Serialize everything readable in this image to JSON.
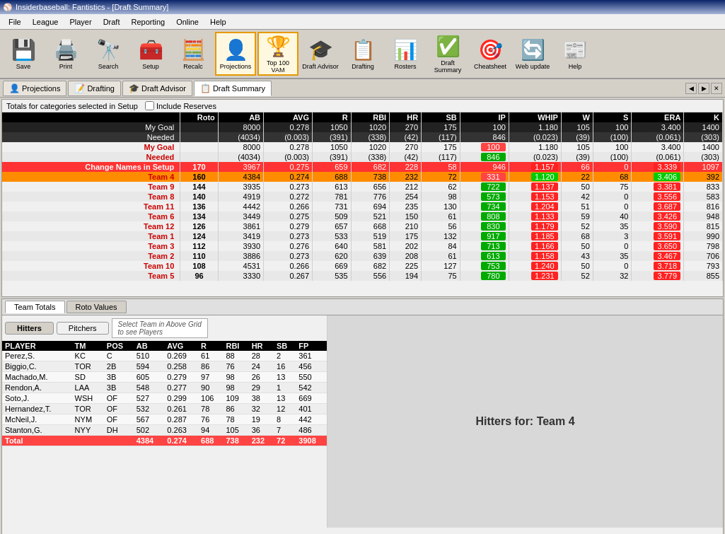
{
  "titlebar": {
    "title": "Insiderbaseball: Fantistics - [Draft Summary]",
    "icon": "⚾"
  },
  "menubar": {
    "items": [
      "File",
      "League",
      "Player",
      "Draft",
      "Reporting",
      "Online",
      "Help"
    ]
  },
  "toolbar": {
    "buttons": [
      {
        "id": "save",
        "label": "Save",
        "icon": "💾"
      },
      {
        "id": "print",
        "label": "Print",
        "icon": "🖨️"
      },
      {
        "id": "search",
        "label": "Search",
        "icon": "🔭"
      },
      {
        "id": "setup",
        "label": "Setup",
        "icon": "🧰"
      },
      {
        "id": "recalc",
        "label": "Recalc",
        "icon": "🧮"
      },
      {
        "id": "projections",
        "label": "Projections",
        "icon": "👤"
      },
      {
        "id": "top100",
        "label": "Top 100 VAM",
        "icon": "🏆"
      },
      {
        "id": "advisor",
        "label": "Draft Advisor",
        "icon": "🎓"
      },
      {
        "id": "drafting",
        "label": "Drafting",
        "icon": "📋"
      },
      {
        "id": "rosters",
        "label": "Rosters",
        "icon": "📊"
      },
      {
        "id": "draftsummary",
        "label": "Draft Summary",
        "icon": "✅"
      },
      {
        "id": "cheatsheet",
        "label": "Cheatsheet",
        "icon": "🎯"
      },
      {
        "id": "webupdate",
        "label": "Web update",
        "icon": "🔄"
      },
      {
        "id": "help",
        "label": "Help",
        "icon": "📰"
      }
    ]
  },
  "tabs": [
    {
      "id": "projections",
      "label": "Projections",
      "icon": "👤",
      "active": false
    },
    {
      "id": "drafting",
      "label": "Drafting",
      "icon": "📝",
      "active": false
    },
    {
      "id": "draftadvisor",
      "label": "Draft Advisor",
      "icon": "🎓",
      "active": false
    },
    {
      "id": "draftsummary",
      "label": "Draft Summary",
      "icon": "📋",
      "active": true
    }
  ],
  "grid": {
    "totals_label": "Totals for categories selected in Setup",
    "include_reserves_label": "Include Reserves",
    "columns": [
      "",
      "Roto",
      "AB",
      "AVG",
      "R",
      "RBI",
      "HR",
      "SB",
      "IP",
      "WHIP",
      "W",
      "S",
      "ERA",
      "K"
    ],
    "rows": [
      {
        "label": "My Goal",
        "roto": "",
        "ab": "8000",
        "avg": "0.278",
        "r": "1050",
        "rbi": "1020",
        "hr": "270",
        "sb": "175",
        "ip": "100",
        "whip": "1.180",
        "w": "105",
        "s": "100",
        "era": "3.400",
        "k": "1400",
        "type": "goal"
      },
      {
        "label": "Needed",
        "roto": "",
        "ab": "(4034)",
        "avg": "(0.003)",
        "r": "(391)",
        "rbi": "(338)",
        "hr": "(42)",
        "sb": "(117)",
        "ip": "846",
        "whip": "(0.023)",
        "w": "(39)",
        "s": "(100)",
        "era": "(0.061)",
        "k": "(303)",
        "type": "needed"
      },
      {
        "label": "Change Names in Setup",
        "roto": "170",
        "ab": "3967",
        "avg": "0.275",
        "r": "659",
        "rbi": "682",
        "hr": "228",
        "sb": "58",
        "ip": "946",
        "whip": "1.157",
        "w": "66",
        "s": "0",
        "era": "3.339",
        "k": "1097",
        "type": "change"
      },
      {
        "label": "Team 4",
        "roto": "160",
        "ab": "4384",
        "avg": "0.274",
        "r": "688",
        "rbi": "738",
        "hr": "232",
        "sb": "72",
        "ip": "331",
        "whip": "1.120",
        "w": "22",
        "s": "68",
        "era": "3.406",
        "k": "392",
        "type": "team4"
      },
      {
        "label": "Team 9",
        "roto": "144",
        "ab": "3935",
        "avg": "0.273",
        "r": "613",
        "rbi": "656",
        "hr": "212",
        "sb": "62",
        "ip": "722",
        "whip": "1.137",
        "w": "50",
        "s": "75",
        "era": "3.381",
        "k": "833",
        "type": "normal"
      },
      {
        "label": "Team 8",
        "roto": "140",
        "ab": "4919",
        "avg": "0.272",
        "r": "781",
        "rbi": "776",
        "hr": "254",
        "sb": "98",
        "ip": "573",
        "whip": "1.153",
        "w": "42",
        "s": "0",
        "era": "3.556",
        "k": "583",
        "type": "normal"
      },
      {
        "label": "Team 11",
        "roto": "136",
        "ab": "4442",
        "avg": "0.266",
        "r": "731",
        "rbi": "694",
        "hr": "235",
        "sb": "130",
        "ip": "734",
        "whip": "1.204",
        "w": "51",
        "s": "0",
        "era": "3.687",
        "k": "816",
        "type": "normal"
      },
      {
        "label": "Team 6",
        "roto": "134",
        "ab": "3449",
        "avg": "0.275",
        "r": "509",
        "rbi": "521",
        "hr": "150",
        "sb": "61",
        "ip": "808",
        "whip": "1.133",
        "w": "59",
        "s": "40",
        "era": "3.426",
        "k": "948",
        "type": "normal"
      },
      {
        "label": "Team 12",
        "roto": "126",
        "ab": "3861",
        "avg": "0.279",
        "r": "657",
        "rbi": "668",
        "hr": "210",
        "sb": "56",
        "ip": "830",
        "whip": "1.179",
        "w": "52",
        "s": "35",
        "era": "3.590",
        "k": "815",
        "type": "normal"
      },
      {
        "label": "Team 1",
        "roto": "124",
        "ab": "3419",
        "avg": "0.273",
        "r": "533",
        "rbi": "519",
        "hr": "175",
        "sb": "132",
        "ip": "917",
        "whip": "1.185",
        "w": "68",
        "s": "3",
        "era": "3.591",
        "k": "990",
        "type": "normal"
      },
      {
        "label": "Team 3",
        "roto": "112",
        "ab": "3930",
        "avg": "0.276",
        "r": "640",
        "rbi": "581",
        "hr": "202",
        "sb": "84",
        "ip": "713",
        "whip": "1.166",
        "w": "50",
        "s": "0",
        "era": "3.650",
        "k": "798",
        "type": "normal"
      },
      {
        "label": "Team 2",
        "roto": "110",
        "ab": "3886",
        "avg": "0.273",
        "r": "620",
        "rbi": "639",
        "hr": "208",
        "sb": "61",
        "ip": "613",
        "whip": "1.158",
        "w": "43",
        "s": "35",
        "era": "3.467",
        "k": "706",
        "type": "normal"
      },
      {
        "label": "Team 10",
        "roto": "108",
        "ab": "4531",
        "avg": "0.266",
        "r": "669",
        "rbi": "682",
        "hr": "225",
        "sb": "127",
        "ip": "753",
        "whip": "1.240",
        "w": "50",
        "s": "0",
        "era": "3.718",
        "k": "793",
        "type": "normal"
      },
      {
        "label": "Team 5",
        "roto": "96",
        "ab": "3330",
        "avg": "0.267",
        "r": "535",
        "rbi": "556",
        "hr": "194",
        "sb": "75",
        "ip": "780",
        "whip": "1.231",
        "w": "52",
        "s": "32",
        "era": "3.779",
        "k": "855",
        "type": "normal"
      }
    ]
  },
  "bottom": {
    "tabs": [
      "Team Totals",
      "Roto Values"
    ],
    "active_tab": "Team Totals",
    "hitter_pitcher": {
      "hitter_label": "Hitters",
      "pitcher_label": "Pitchers",
      "note": "Select Team in Above Grid\nto see Players",
      "active": "hitters"
    },
    "right_header": "Hitters for: Team 4",
    "player_columns": [
      "PLAYER",
      "TM",
      "POS",
      "AB",
      "AVG",
      "R",
      "RBI",
      "HR",
      "SB",
      "FP"
    ],
    "players": [
      {
        "player": "Perez,S.",
        "tm": "KC",
        "pos": "C",
        "ab": "510",
        "avg": "0.269",
        "r": "61",
        "rbi": "88",
        "hr": "28",
        "sb": "2",
        "fp": "361"
      },
      {
        "player": "Biggio,C.",
        "tm": "TOR",
        "pos": "2B",
        "ab": "594",
        "avg": "0.258",
        "r": "86",
        "rbi": "76",
        "hr": "24",
        "sb": "16",
        "fp": "456"
      },
      {
        "player": "Machado,M.",
        "tm": "SD",
        "pos": "3B",
        "ab": "605",
        "avg": "0.279",
        "r": "97",
        "rbi": "98",
        "hr": "26",
        "sb": "13",
        "fp": "550"
      },
      {
        "player": "Rendon,A.",
        "tm": "LAA",
        "pos": "3B",
        "ab": "548",
        "avg": "0.277",
        "r": "90",
        "rbi": "98",
        "hr": "29",
        "sb": "1",
        "fp": "542"
      },
      {
        "player": "Soto,J.",
        "tm": "WSH",
        "pos": "OF",
        "ab": "527",
        "avg": "0.299",
        "r": "106",
        "rbi": "109",
        "hr": "38",
        "sb": "13",
        "fp": "669"
      },
      {
        "player": "Hernandez,T.",
        "tm": "TOR",
        "pos": "OF",
        "ab": "532",
        "avg": "0.261",
        "r": "78",
        "rbi": "86",
        "hr": "32",
        "sb": "12",
        "fp": "401"
      },
      {
        "player": "McNeil,J.",
        "tm": "NYM",
        "pos": "OF",
        "ab": "567",
        "avg": "0.287",
        "r": "76",
        "rbi": "78",
        "hr": "19",
        "sb": "8",
        "fp": "442"
      },
      {
        "player": "Stanton,G.",
        "tm": "NYY",
        "pos": "DH",
        "ab": "502",
        "avg": "0.263",
        "r": "94",
        "rbi": "105",
        "hr": "36",
        "sb": "7",
        "fp": "486"
      }
    ],
    "total_row": {
      "player": "Total",
      "tm": "",
      "pos": "",
      "ab": "4384",
      "avg": "0.274",
      "r": "688",
      "rbi": "738",
      "hr": "232",
      "sb": "72",
      "fp": "3908"
    }
  }
}
